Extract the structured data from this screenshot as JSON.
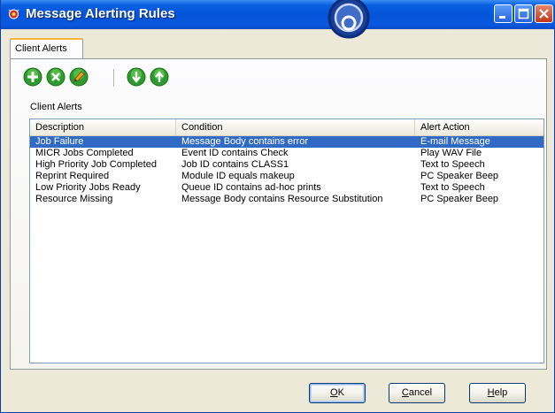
{
  "window": {
    "title": "Message Alerting Rules"
  },
  "tabs": [
    {
      "label": "Client Alerts"
    }
  ],
  "toolbar": {
    "buttons": [
      {
        "name": "add",
        "icon": "plus-icon",
        "color": "#2e9b2e"
      },
      {
        "name": "delete",
        "icon": "x-icon",
        "color": "#2e9b2e"
      },
      {
        "name": "edit",
        "icon": "pencil-icon",
        "color": "#2e9b2e"
      },
      {
        "name": "move-down",
        "icon": "arrow-down-icon",
        "color": "#2e9b2e"
      },
      {
        "name": "move-up",
        "icon": "arrow-up-icon",
        "color": "#2e9b2e"
      }
    ]
  },
  "alerts": {
    "group_label": "Client Alerts",
    "columns": [
      "Description",
      "Condition",
      "Alert Action"
    ],
    "rows": [
      {
        "description": "Job Failure",
        "condition": "Message Body contains error",
        "action": "E-mail Message",
        "selected": true
      },
      {
        "description": "MICR Jobs Completed",
        "condition": "Event ID contains Check",
        "action": "Play WAV File",
        "selected": false
      },
      {
        "description": "High Priority Job Completed",
        "condition": "Job ID contains CLASS1",
        "action": "Text to Speech",
        "selected": false
      },
      {
        "description": "Reprint Required",
        "condition": "Module ID equals makeup",
        "action": "PC Speaker Beep",
        "selected": false
      },
      {
        "description": "Low Priority Jobs Ready",
        "condition": "Queue ID contains ad-hoc prints",
        "action": "Text to Speech",
        "selected": false
      },
      {
        "description": "Resource Missing",
        "condition": "Message Body contains Resource Substitution",
        "action": "PC Speaker Beep",
        "selected": false
      }
    ]
  },
  "buttons": {
    "ok_mnemonic": "O",
    "ok_rest": "K",
    "cancel_mnemonic": "C",
    "cancel_rest": "ancel",
    "help_mnemonic": "H",
    "help_rest": "elp"
  },
  "colors": {
    "titlebar": "#0453d8",
    "selection": "#316ac5",
    "tab_highlight": "#f5b43b"
  }
}
